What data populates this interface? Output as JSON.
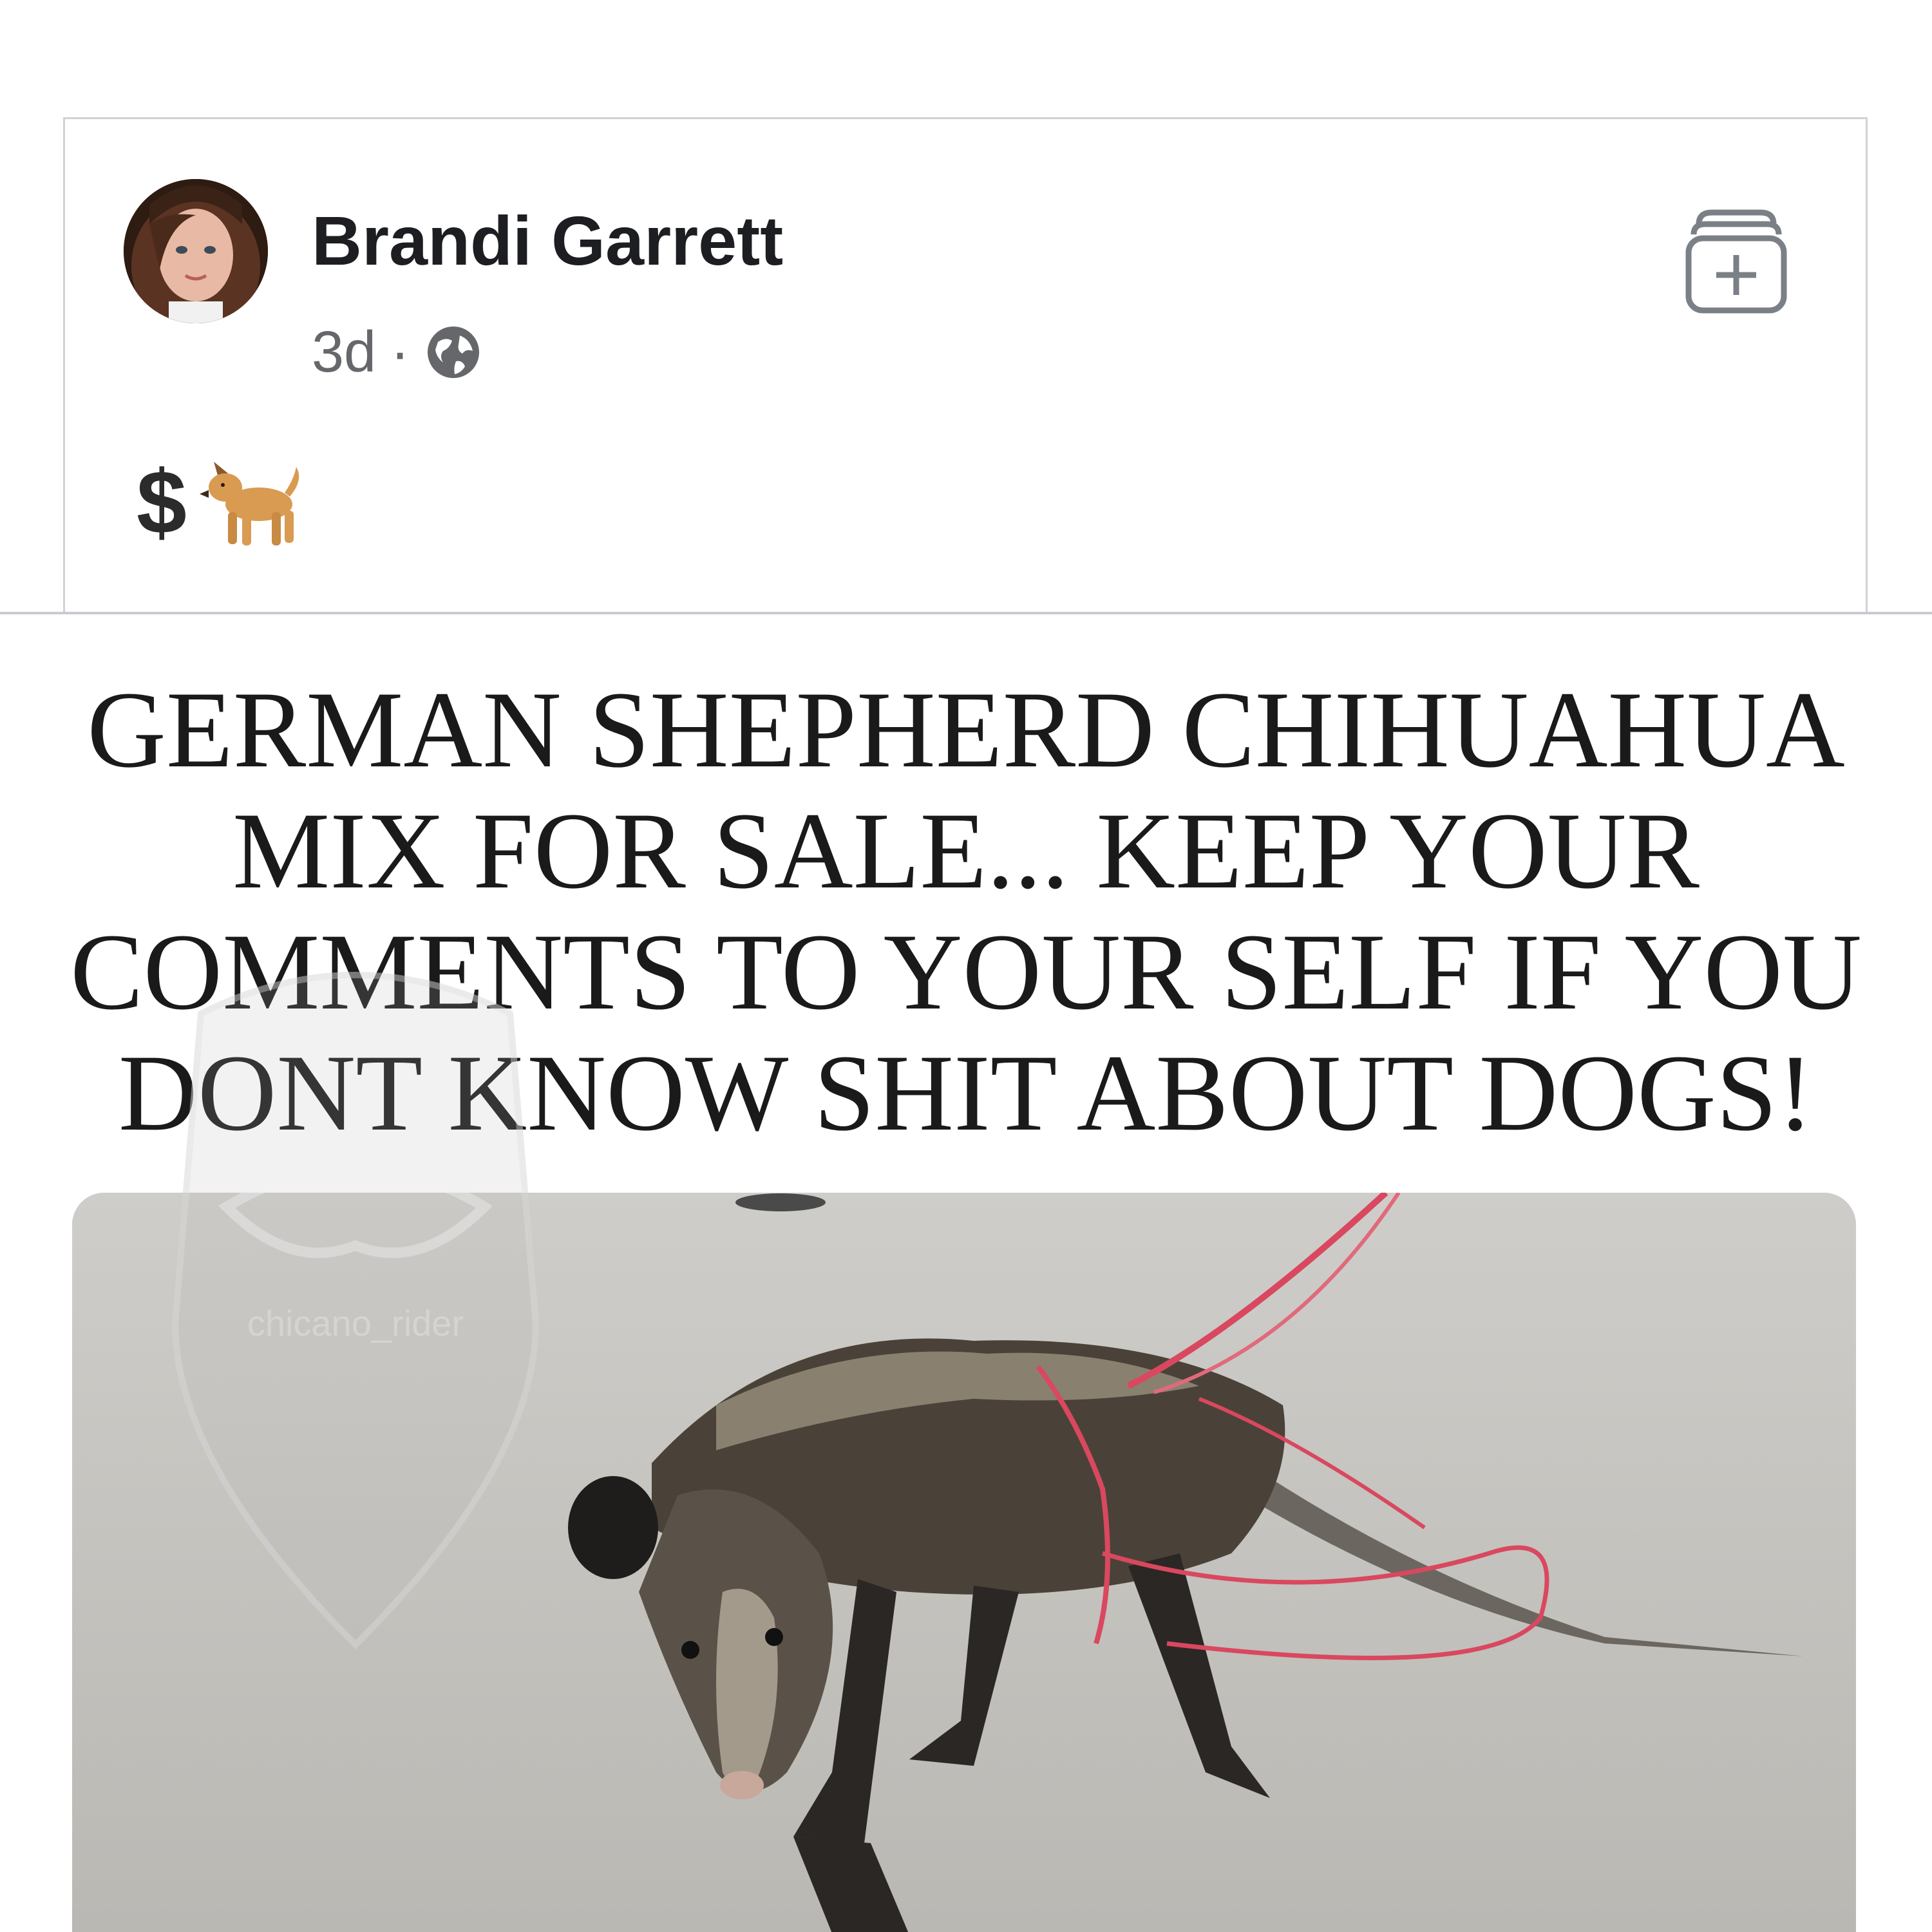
{
  "post": {
    "author_name": "Brandi Garrett",
    "time": "3d",
    "separator": "·",
    "privacy_icon": "globe-icon",
    "save_icon": "bookmark-add-icon",
    "text_symbol": "$",
    "text_emoji_icon": "dog-emoji-icon"
  },
  "meme": {
    "caption": "GERMAN SHEPHERD CHIHUAHUA\nMIX FOR SALE... KEEP YOUR\nCOMMENTS TO YOUR SELF IF YOU\nDONT KNOW SHIT ABOUT DOGS!",
    "watermark_text": "chicano_rider"
  },
  "colors": {
    "name_text": "#1c1e21",
    "meta_text": "#65676b",
    "border": "#cfd2d6",
    "caption_text": "#1a1a1a",
    "leash": "#d9485f"
  }
}
